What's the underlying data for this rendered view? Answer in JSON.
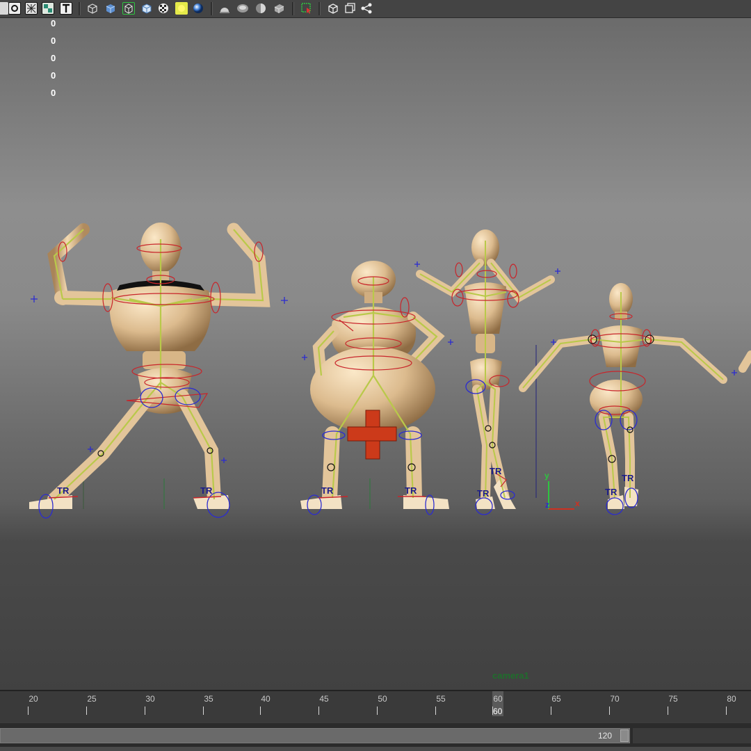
{
  "toolbar": {
    "icons": [
      "select-mode-icon",
      "wireframe-toggle-icon",
      "xray-icon",
      "textured-icon",
      "text-icon",
      "bounding-box-icon",
      "smooth-shade-icon",
      "wireframe-on-shaded-icon",
      "flat-shade-icon",
      "checker-icon",
      "default-light-icon",
      "shaded-sphere-icon",
      "dome-icon",
      "sphere-shaded-icon",
      "half-sphere-icon",
      "cube-shaded-icon",
      "isolate-select-icon",
      "camera-icon",
      "frame-icon",
      "share-icon"
    ]
  },
  "hud": {
    "values": [
      "0",
      "0",
      "0",
      "0",
      "0"
    ]
  },
  "viewport": {
    "camera_label": "camera1",
    "axis_labels": {
      "x": "x",
      "y": "y",
      "z": "z"
    },
    "ik_labels": [
      "TR",
      "TR",
      "TR",
      "TR",
      "TR",
      "TR",
      "TR",
      "TR"
    ],
    "characters": [
      "muscle-pose-figure",
      "fat-figure-hands-on-hips",
      "slim-figure-hands-behind-head",
      "small-figure-arms-out",
      "partial-figure-edge"
    ]
  },
  "timeline": {
    "ticks": [
      "20",
      "25",
      "30",
      "35",
      "40",
      "45",
      "50",
      "55",
      "60",
      "65",
      "70",
      "75",
      "80"
    ],
    "current_frame": "60"
  },
  "range": {
    "end_frame": "120"
  },
  "colors": {
    "viewport_top": "#6b6b6b",
    "viewport_mid": "#8e8e8e",
    "viewport_bottom": "#414141",
    "body": "#e6cba5",
    "bone": "#b9c94a",
    "control_red": "#c8242a",
    "control_blue": "#2b2bd0",
    "camera_label": "#1f6e2c"
  }
}
